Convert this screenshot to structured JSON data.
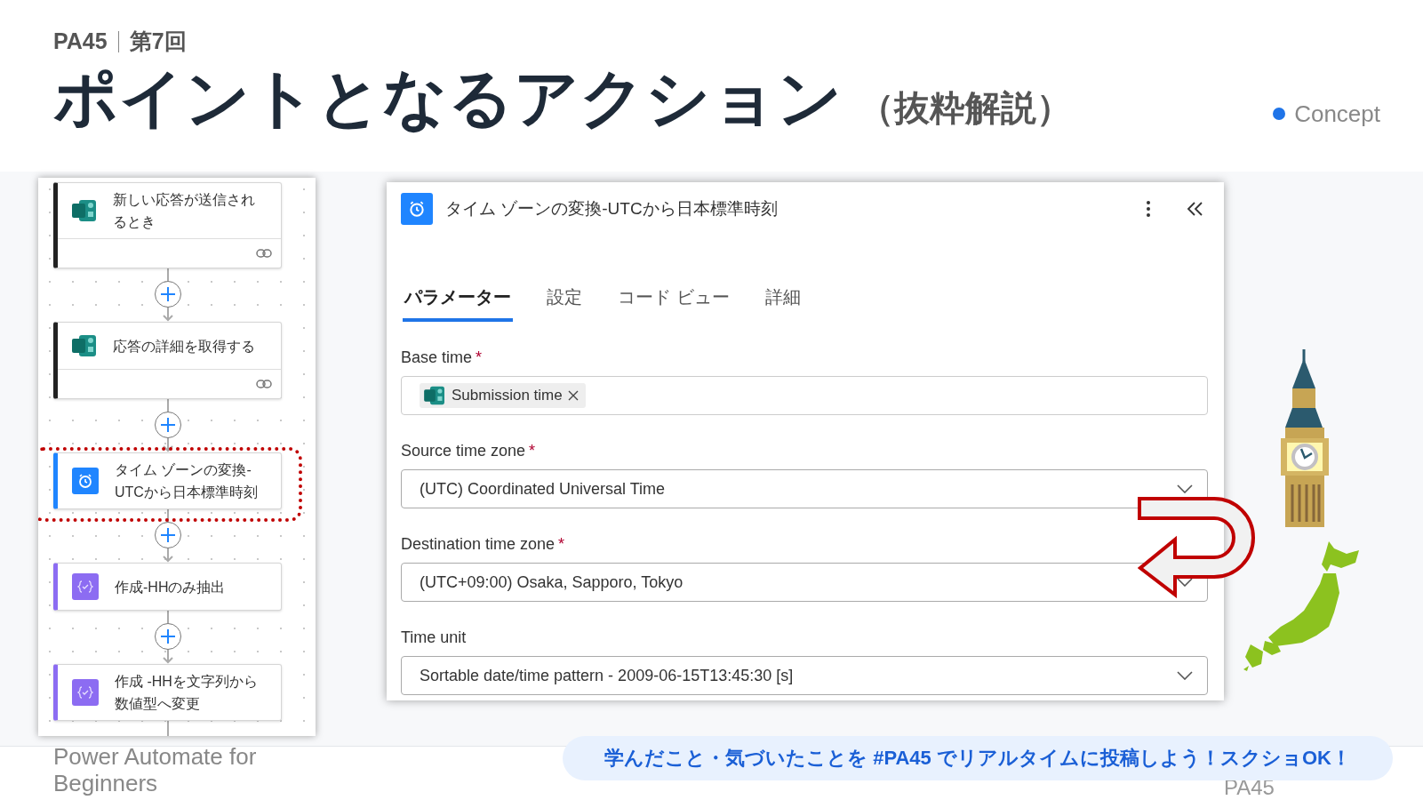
{
  "slide": {
    "course": "PA45",
    "session": "第7回",
    "title": "ポイントとなるアクション",
    "subtitle": "（抜粋解説）",
    "tag": "Concept"
  },
  "flow": {
    "steps": [
      {
        "kind": "forms",
        "title": "新しい応答が送信されるとき",
        "highlighted": false
      },
      {
        "kind": "forms",
        "title": "応答の詳細を取得する",
        "highlighted": false
      },
      {
        "kind": "schedule",
        "title": "タイム ゾーンの変換-UTCから日本標準時刻",
        "highlighted": true
      },
      {
        "kind": "compose",
        "title": "作成-HHのみ抽出",
        "highlighted": false
      },
      {
        "kind": "compose",
        "title": "作成 -HHを文字列から数値型へ変更",
        "highlighted": false
      }
    ]
  },
  "panel": {
    "title": "タイム ゾーンの変換-UTCから日本標準時刻",
    "tabs": [
      {
        "label": "パラメーター",
        "selected": true
      },
      {
        "label": "設定",
        "selected": false
      },
      {
        "label": "コード ビュー",
        "selected": false
      },
      {
        "label": "詳細",
        "selected": false
      }
    ],
    "fields": [
      {
        "kind": "token",
        "label": "Base time",
        "required_mark": "*",
        "value": "Submission time"
      },
      {
        "kind": "dropdown",
        "label": "Source time zone",
        "required_mark": "*",
        "value": "(UTC) Coordinated Universal Time"
      },
      {
        "kind": "dropdown",
        "label": "Destination time zone",
        "required_mark": "*",
        "value": "(UTC+09:00) Osaka, Sapporo, Tokyo"
      },
      {
        "kind": "dropdown",
        "label": "Time unit",
        "value": "Sortable date/time pattern - 2009-06-15T13:45:30 [s]"
      }
    ]
  },
  "footer": {
    "course_name": "Power Automate for Beginners",
    "banner": "学んだこと・気づいたことを #PA45 でリアルタイムに投稿しよう！スクショOK！",
    "page_label": "PA45"
  }
}
